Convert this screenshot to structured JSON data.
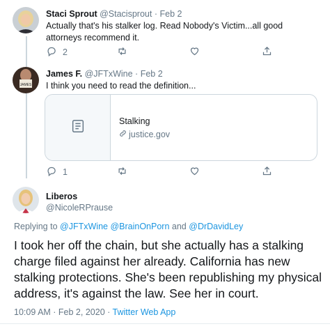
{
  "tweets": [
    {
      "name": "Staci Sprout",
      "handle": "@Stacisprout",
      "date": "Feb 2",
      "text": "Actually that's his stalker log. Read Nobody's Victim...all good attorneys recommend it.",
      "reply_count": "2",
      "retweet_count": "",
      "like_count": ""
    },
    {
      "name": "James F.",
      "handle": "@JFTxWine",
      "date": "Feb 2",
      "text": "I think you need to read the definition...",
      "avatar_text": "JAMES",
      "card": {
        "title": "Stalking",
        "domain": "justice.gov"
      },
      "reply_count": "1",
      "retweet_count": "",
      "like_count": ""
    }
  ],
  "main_tweet": {
    "name": "Liberos",
    "handle": "@NicoleRPrause",
    "replying_prefix": "Replying to",
    "reply_handles": [
      "@JFTxWine",
      "@BrainOnPorn",
      "@DrDavidLey"
    ],
    "reply_and": "and",
    "text": "I took her off the chain, but she actually has a stalking charge filed against her already. California has new stalking protections. She's been republishing my physical address, it's against the law. See her in court.",
    "timestamp": "10:09 AM · Feb 2, 2020",
    "source_sep": "·",
    "source": "Twitter Web App"
  },
  "colors": {
    "link": "#1b95e0",
    "muted": "#657786",
    "text": "#14171a",
    "border": "#ccd6dd"
  },
  "icons": [
    "reply-icon",
    "retweet-icon",
    "like-icon",
    "share-icon",
    "article-icon",
    "link-icon"
  ]
}
